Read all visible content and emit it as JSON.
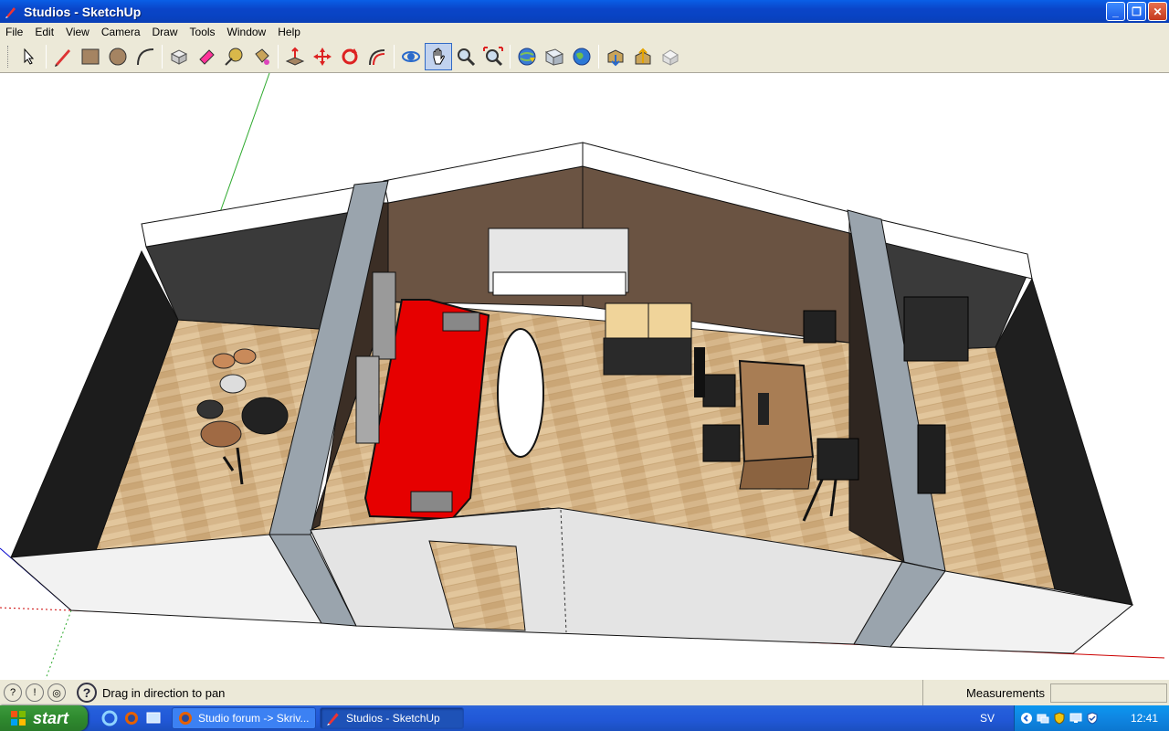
{
  "window": {
    "title": "Studios - SketchUp",
    "buttons": [
      "_",
      "❐",
      "✕"
    ]
  },
  "menu": [
    "File",
    "Edit",
    "View",
    "Camera",
    "Draw",
    "Tools",
    "Window",
    "Help"
  ],
  "toolbar": {
    "tools": [
      {
        "name": "select-tool",
        "icon": "arrow-icon"
      },
      {
        "name": "pencil-tool",
        "icon": "pencil-icon"
      },
      {
        "name": "rectangle-tool",
        "icon": "rectangle-icon"
      },
      {
        "name": "circle-tool",
        "icon": "circle-icon"
      },
      {
        "name": "arc-tool",
        "icon": "arc-icon"
      },
      {
        "name": "make-component-tool",
        "icon": "component-icon"
      },
      {
        "name": "eraser-tool",
        "icon": "eraser-icon"
      },
      {
        "name": "tape-measure-tool",
        "icon": "tape-icon"
      },
      {
        "name": "paint-bucket-tool",
        "icon": "bucket-icon"
      },
      {
        "name": "push-pull-tool",
        "icon": "pushpull-icon"
      },
      {
        "name": "move-tool",
        "icon": "move-icon"
      },
      {
        "name": "rotate-tool",
        "icon": "rotate-icon"
      },
      {
        "name": "offset-tool",
        "icon": "offset-icon"
      },
      {
        "name": "orbit-tool",
        "icon": "orbit-icon"
      },
      {
        "name": "pan-tool",
        "icon": "hand-icon",
        "active": true
      },
      {
        "name": "zoom-tool",
        "icon": "magnifier-icon"
      },
      {
        "name": "zoom-extents-tool",
        "icon": "zoom-extents-icon"
      },
      {
        "name": "get-models-tool",
        "icon": "globe-icon"
      },
      {
        "name": "share-model-tool",
        "icon": "share-icon"
      },
      {
        "name": "google-earth-tool",
        "icon": "earth-icon"
      },
      {
        "name": "get-components-tool",
        "icon": "warehouse-icon"
      },
      {
        "name": "share-component-tool",
        "icon": "share-component-icon"
      },
      {
        "name": "dynamic-components-tool",
        "icon": "dynamic-icon"
      }
    ]
  },
  "status": {
    "hint": "Drag in direction to pan",
    "measurements_label": "Measurements",
    "measurements_value": ""
  },
  "taskbar": {
    "start_label": "start",
    "tasks": [
      {
        "label": "Studio forum -> Skriv...",
        "active": false
      },
      {
        "label": "Studios - SketchUp",
        "active": true
      }
    ],
    "tray_lang": "SV",
    "clock": "12:41"
  },
  "colors": {
    "titlebar": "#0a45c8",
    "floor": "#d8b98c",
    "sofa": "#e60000",
    "wall_brown": "#6b5443",
    "wall_dark": "#2a2a2a",
    "column_grey": "#9aa4ad"
  }
}
